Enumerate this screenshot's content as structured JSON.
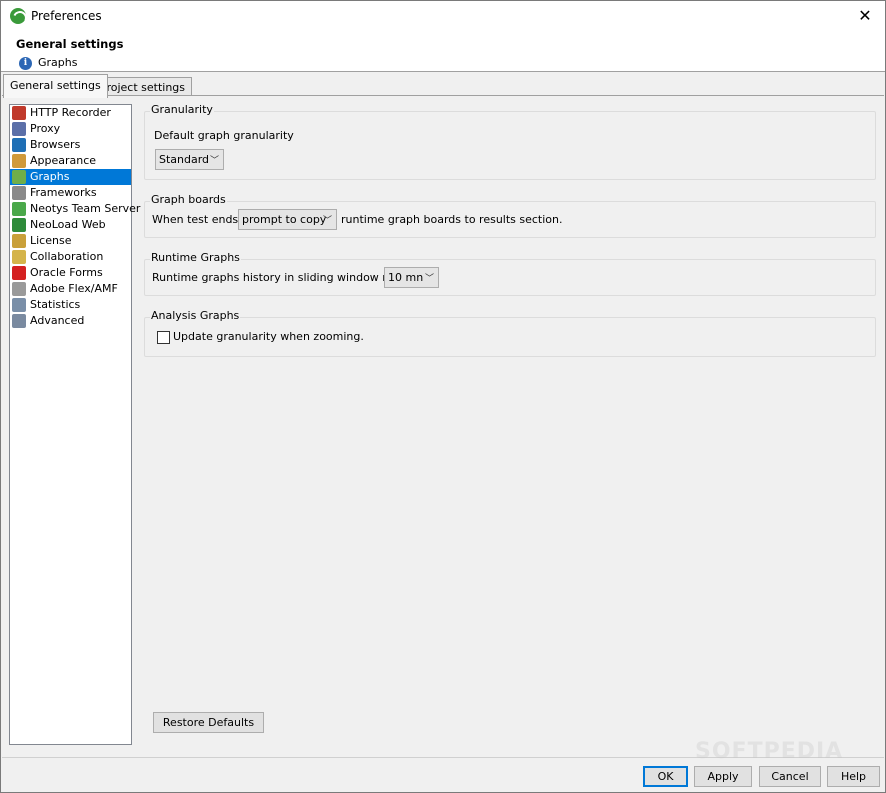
{
  "window": {
    "title": "Preferences",
    "close_glyph": "✕"
  },
  "header": {
    "title": "General settings",
    "subtitle": "Graphs",
    "info_glyph": "i"
  },
  "tabs": [
    {
      "label": "General settings",
      "active": true
    },
    {
      "label": "Project settings",
      "active": false
    }
  ],
  "sidebar": {
    "items": [
      {
        "label": "HTTP Recorder",
        "icon": "recorder-icon",
        "color": "#c0392b"
      },
      {
        "label": "Proxy",
        "icon": "proxy-icon",
        "color": "#5b6fa8"
      },
      {
        "label": "Browsers",
        "icon": "globe-icon",
        "color": "#1f6fb5"
      },
      {
        "label": "Appearance",
        "icon": "palette-icon",
        "color": "#d09a3a"
      },
      {
        "label": "Graphs",
        "icon": "graph-icon",
        "color": "#6fae4a",
        "selected": true
      },
      {
        "label": "Frameworks",
        "icon": "gears-icon",
        "color": "#8a8a8a"
      },
      {
        "label": "Neotys Team Server",
        "icon": "neotys-icon",
        "color": "#4aa84a"
      },
      {
        "label": "NeoLoad Web",
        "icon": "neoload-web-icon",
        "color": "#2e8b3a"
      },
      {
        "label": "License",
        "icon": "key-icon",
        "color": "#c9a03a"
      },
      {
        "label": "Collaboration",
        "icon": "database-icon",
        "color": "#d4b44a"
      },
      {
        "label": "Oracle Forms",
        "icon": "oracle-icon",
        "color": "#d42020"
      },
      {
        "label": "Adobe Flex/AMF",
        "icon": "flex-icon",
        "color": "#9a9a9a"
      },
      {
        "label": "Statistics",
        "icon": "statistics-icon",
        "color": "#7a8fa8"
      },
      {
        "label": "Advanced",
        "icon": "gear-icon",
        "color": "#7a8aa0"
      }
    ]
  },
  "granularity": {
    "title": "Granularity",
    "label": "Default graph granularity",
    "value": "Standard"
  },
  "graph_boards": {
    "title": "Graph boards",
    "label_before": "When test ends,",
    "value": "prompt to copy",
    "label_after": "runtime graph boards to results section."
  },
  "runtime_graphs": {
    "title": "Runtime Graphs",
    "label": "Runtime graphs history in sliding window mode:",
    "value": "10 mn"
  },
  "analysis_graphs": {
    "title": "Analysis Graphs",
    "checkbox_label": "Update granularity when zooming.",
    "checked": false
  },
  "buttons": {
    "restore_defaults": "Restore Defaults",
    "ok": "OK",
    "apply": "Apply",
    "cancel": "Cancel",
    "help": "Help"
  },
  "chevron_glyph": "﹀",
  "watermark": "SOFTPEDIA"
}
